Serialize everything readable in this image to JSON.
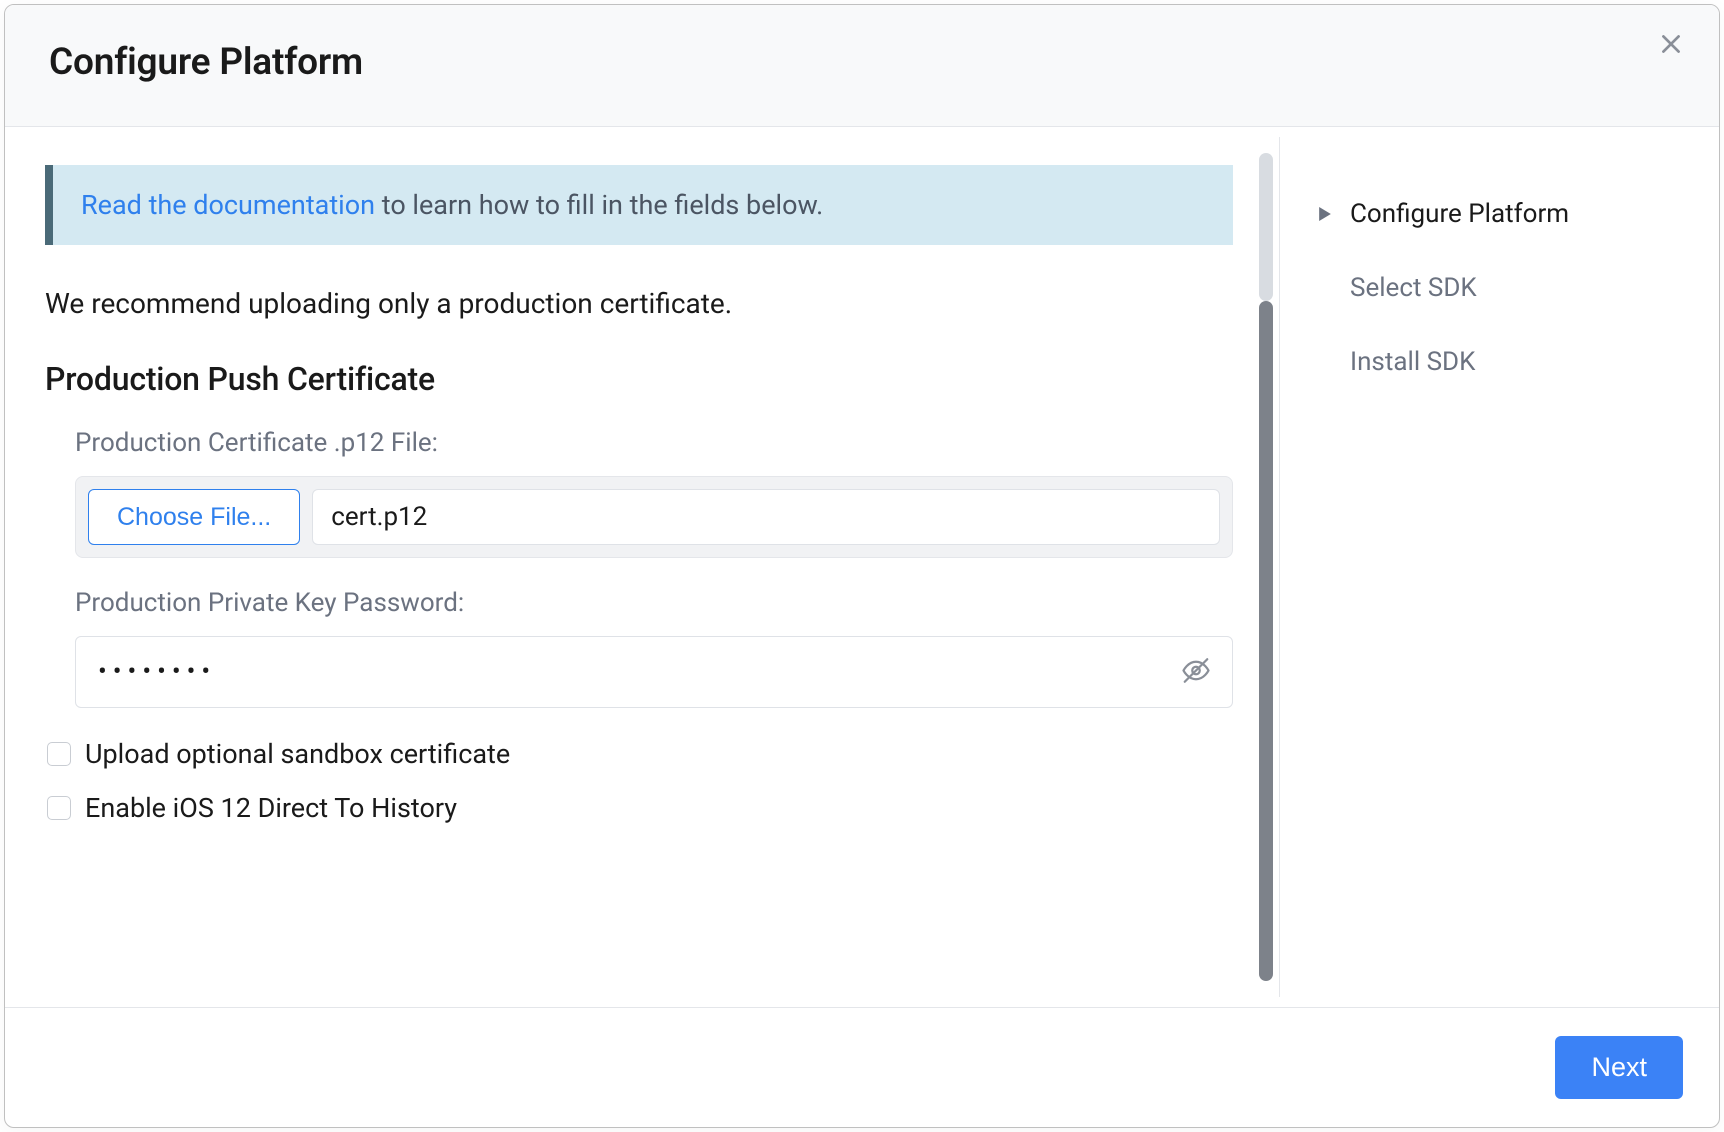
{
  "modal": {
    "title": "Configure Platform"
  },
  "banner": {
    "link_text": "Read the documentation",
    "rest_text": " to learn how to fill in the fields below."
  },
  "recommend_text": "We recommend uploading only a production certificate.",
  "section": {
    "title": "Production Push Certificate",
    "file_label": "Production Certificate .p12 File:",
    "choose_label": "Choose File...",
    "file_name": "cert.p12",
    "password_label": "Production Private Key Password:",
    "password_value": "••••••••"
  },
  "checkboxes": {
    "sandbox": "Upload optional sandbox certificate",
    "ios12": "Enable iOS 12 Direct To History"
  },
  "steps": [
    {
      "label": "Configure Platform",
      "active": true
    },
    {
      "label": "Select SDK",
      "active": false
    },
    {
      "label": "Install SDK",
      "active": false
    }
  ],
  "footer": {
    "next_label": "Next"
  }
}
